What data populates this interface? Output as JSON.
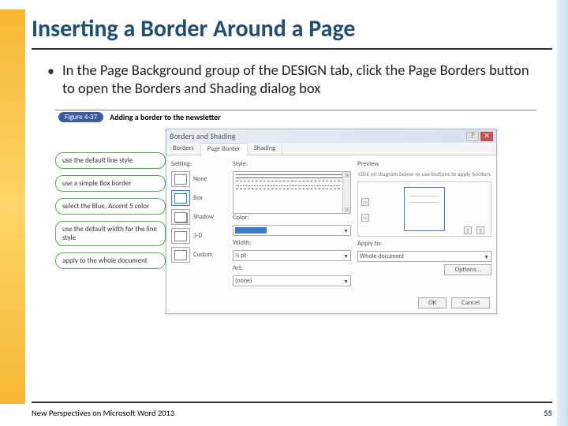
{
  "title": "Inserting a Border Around a Page",
  "bullet": "In the Page Background group of the DESIGN tab, click the Page Borders button to open the Borders and Shading dialog box",
  "figure": {
    "num": "Figure 4-37",
    "caption": "Adding a border to the newsletter"
  },
  "callouts": [
    "use the default line style",
    "use a simple Box border",
    "select the Blue, Accent 5 color",
    "use the default width for the line style",
    "apply to the whole document"
  ],
  "dialog": {
    "title": "Borders and Shading",
    "tabs": [
      "Borders",
      "Page Border",
      "Shading"
    ],
    "activeTab": 1,
    "setting": {
      "label": "Setting:",
      "options": [
        "None",
        "Box",
        "Shadow",
        "3-D",
        "Custom"
      ]
    },
    "style": {
      "label": "Style:",
      "colorLabel": "Color:",
      "widthLabel": "Width:",
      "widthValue": "½ pt",
      "artLabel": "Art:",
      "artValue": "(none)"
    },
    "preview": {
      "label": "Preview",
      "text": "Click on diagram below or use buttons to apply borders",
      "applyLabel": "Apply to:",
      "applyValue": "Whole document",
      "options": "Options..."
    },
    "buttons": {
      "ok": "OK",
      "cancel": "Cancel"
    }
  },
  "footer": {
    "left": "New Perspectives on Microsoft Word 2013",
    "right": "55"
  }
}
